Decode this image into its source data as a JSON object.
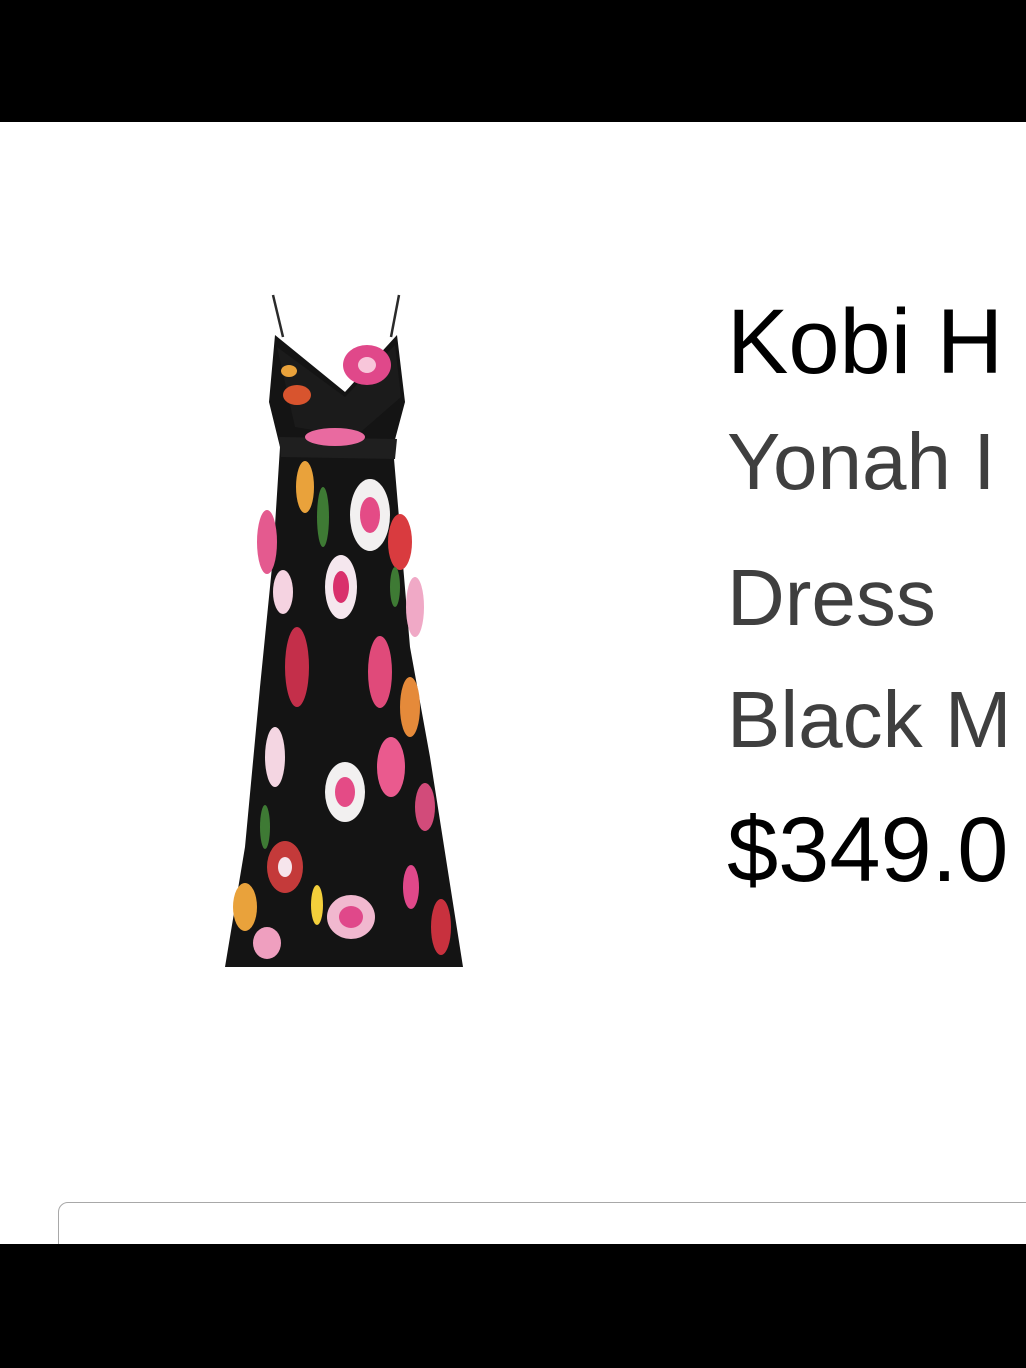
{
  "product": {
    "brand": "Kobi H",
    "name_line1": "Yonah I",
    "name_line2": "Dress",
    "color": "Black M",
    "price": "$349.0",
    "image_alt": "floral-pleated-maxi-dress"
  },
  "colors": {
    "bar": "#000000",
    "background": "#ffffff",
    "brand_text": "#000000",
    "secondary_text": "#3f3f3f",
    "card_border": "#a8a8a8"
  }
}
